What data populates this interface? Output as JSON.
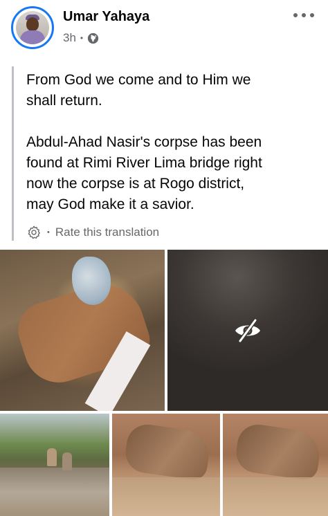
{
  "post": {
    "author": "Umar Yahaya",
    "time": "3h",
    "audience_icon": "globe-icon",
    "text_paragraphs": [
      "From God we come and to Him we\nshall return.",
      "Abdul-Ahad Nasir's corpse has been\nfound at Rimi River Lima bridge right\nnow the corpse is at Rogo district,\nmay God make it a savior."
    ],
    "translation": {
      "label": "Rate this translation",
      "icon": "gear-icon"
    },
    "photos": [
      {
        "content": "photo"
      },
      {
        "content": "hidden-sensitive-photo",
        "icon": "eye-slash-icon"
      },
      {
        "content": "photo"
      },
      {
        "content": "photo"
      },
      {
        "content": "photo"
      }
    ]
  },
  "colors": {
    "accent": "#1877f2",
    "secondary_text": "#65676b",
    "primary_text": "#050505",
    "quote_bar": "#bcc0c4"
  }
}
